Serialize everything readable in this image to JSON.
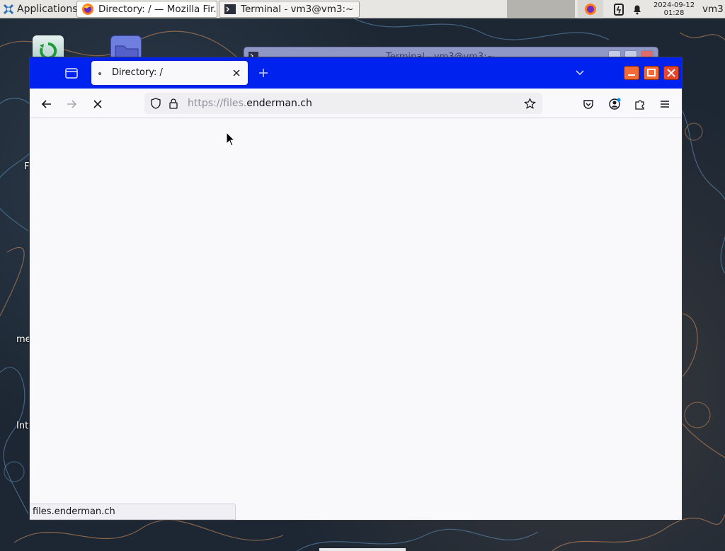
{
  "taskbar": {
    "apps_menu_label": "Applications",
    "tasks": [
      {
        "label": "Directory: / — Mozilla Fir...",
        "icon": "firefox-icon",
        "active": true
      },
      {
        "label": "Terminal - vm3@vm3:~",
        "icon": "terminal-icon",
        "active": false
      }
    ],
    "clock_date": "2024-09-12",
    "clock_time": "01:28",
    "user": "vm3"
  },
  "desktop": {
    "labels": [
      "F",
      "me",
      "Int"
    ]
  },
  "terminal_window": {
    "title": "Terminal - vm3@vm3:~"
  },
  "browser": {
    "tab_title": "Directory: /",
    "url_prefix": "https://files.",
    "url_domain": "enderman.ch",
    "status_text": "files.enderman.ch",
    "tabbar_color": "#0022ee"
  }
}
